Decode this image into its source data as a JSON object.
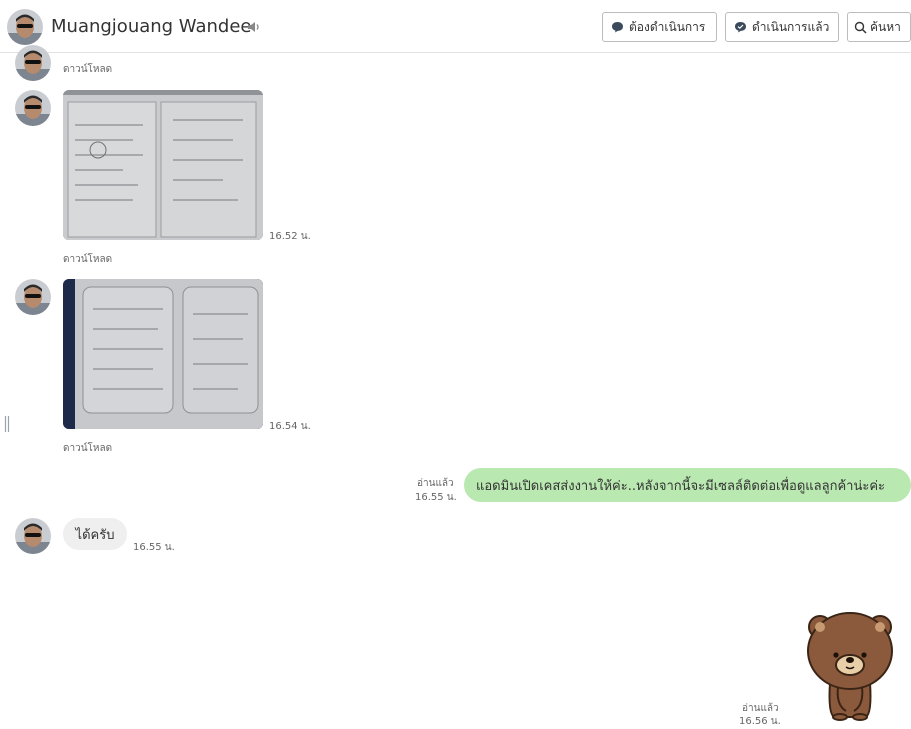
{
  "header": {
    "contact_name": "Muangjouang Wandee",
    "btn_todo": "ต้องดำเนินการ",
    "btn_done": "ดำเนินการแล้ว",
    "btn_search": "ค้นหา"
  },
  "messages": {
    "m1_download": "ดาวน์โหลด",
    "m2_time": "16.52 น.",
    "m2_download": "ดาวน์โหลด",
    "m3_time": "16.54 น.",
    "m3_download": "ดาวน์โหลด",
    "m4_read": "อ่านแล้ว",
    "m4_time": "16.55 น.",
    "m4_text": "แอดมินเปิดเคสส่งงานให้ค่ะ..หลังจากนี้จะมีเซลล์ติดต่อเพื่อดูแลลูกค้าน่ะค่ะ",
    "m5_text": "ได้ครับ",
    "m5_time": "16.55 น.",
    "m6_read": "อ่านแล้ว",
    "m6_time": "16.56 น."
  },
  "icons": {
    "sound": "speaker-icon",
    "todo": "speech-bubble-icon",
    "done": "speech-bubble-check-icon",
    "search": "search-icon"
  },
  "colors": {
    "outgoing_bubble": "#b9e8b0",
    "incoming_bubble": "#efefef"
  }
}
